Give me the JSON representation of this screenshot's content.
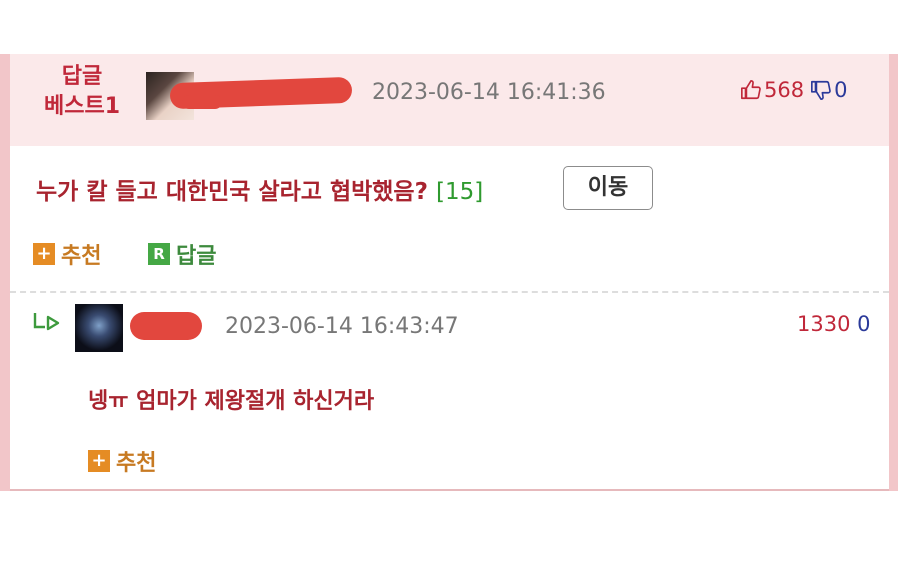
{
  "best_comment": {
    "label_line1": "답글",
    "label_line2": "베스트1",
    "timestamp": "2023-06-14 16:41:36",
    "upvotes": "568",
    "downvotes": "0",
    "title": "누가 칼 들고 대한민국 살라고 협박했음?",
    "reply_count": "[15]",
    "move_button": "이동",
    "recommend_label": "추천",
    "reply_label": "답글",
    "reply_icon_letter": "R"
  },
  "reply": {
    "timestamp": "2023-06-14 16:43:47",
    "upvotes": "1330",
    "downvotes": "0",
    "text": "넹ㅠ 엄마가 제왕절개 하신거라",
    "recommend_label": "추천"
  },
  "icons": {
    "plus": "+",
    "upvote": "thumb-up-icon",
    "downvote": "thumb-down-icon",
    "reply_arrow": "reply-arrow-icon"
  },
  "colors": {
    "accent_red": "#c0283a",
    "header_bg": "#fbe9ea",
    "border_pink": "#f2c6c9",
    "reply_count_green": "#2f9a2f",
    "recommend_orange": "#e58c24",
    "reply_green": "#45a845",
    "downvote_blue": "#2b3a9a"
  }
}
